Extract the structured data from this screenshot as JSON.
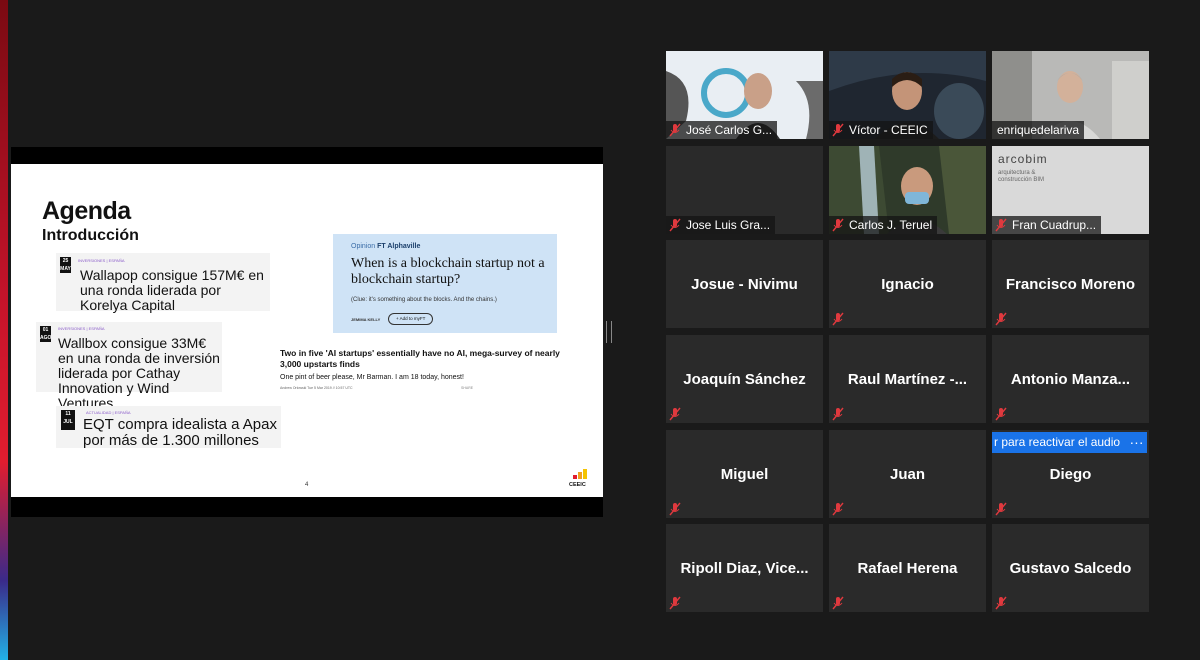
{
  "colors": {
    "background": "#1a1a1a",
    "tile_bg": "#2a2a2a",
    "active_speaker_border": "#c9e36f",
    "muted_icon": "#e0393e",
    "action_blue": "#1a73e8"
  },
  "slide": {
    "title": "Agenda",
    "subtitle": "Introducción",
    "page_number": "4",
    "logo_text": "CEEIC",
    "news": [
      {
        "date_day": "25",
        "date_month": "MAY",
        "tag": "INVERSIONES | España",
        "headline": "Wallapop consigue 157M€ en una ronda liderada por Korelya Capital"
      },
      {
        "date_day": "01",
        "date_month": "AGO",
        "tag": "INVERSIONES | España",
        "headline": "Wallbox consigue 33M€ en una ronda de inversión liderada por Cathay Innovation y Wind Ventures"
      },
      {
        "date_day": "11",
        "date_month": "JUL",
        "tag": "ACTUALIDAD | España",
        "headline": "EQT compra idealista a Apax por más de 1.300 millones"
      }
    ],
    "ft_card": {
      "label_prefix": "Opinion",
      "label_brand": "FT Alphaville",
      "headline": "When is a blockchain startup not a blockchain startup?",
      "clue": "(Clue: it's something about the blocks. And the chains.)",
      "author": "JEMIMA KELLY",
      "add_button": "+ Add to myFT"
    },
    "article": {
      "headline": "Two in five 'AI startups' essentially have no AI, mega-survey of nearly 3,000 upstarts finds",
      "dek": "One pint of beer please, Mr Barman. I am 18 today, honest!",
      "meta": "Andrew Orlowski   Tue 5 Mar 2019 // 10:57 UTC",
      "share": "SHARE"
    }
  },
  "participants": {
    "video_tiles": [
      {
        "name": "José Carlos G...",
        "muted": true,
        "active": false
      },
      {
        "name": "Víctor - CEEIC",
        "muted": true,
        "active": false
      },
      {
        "name": "enriquedelariva",
        "muted": false,
        "active": true
      },
      {
        "name": "Jose Luis Gra...",
        "muted": true,
        "active": false
      },
      {
        "name": "Carlos J. Teruel",
        "muted": true,
        "active": false
      },
      {
        "name": "Fran Cuadrup...",
        "muted": true,
        "active": false
      }
    ],
    "avatar_tiles": [
      {
        "name": "Josue - Nivimu"
      },
      {
        "name": "Ignacio"
      },
      {
        "name": "Francisco Moreno"
      },
      {
        "name": "Joaquín Sánchez"
      },
      {
        "name": "Raul Martínez -..."
      },
      {
        "name": "Antonio Manza..."
      },
      {
        "name": "Miguel"
      },
      {
        "name": "Juan"
      },
      {
        "name": "Diego"
      },
      {
        "name": "Ripoll Diaz, Vice..."
      },
      {
        "name": "Rafael Herena"
      },
      {
        "name": "Gustavo Salcedo"
      }
    ],
    "arcobim": {
      "logo": "arcobim",
      "tagline": "arquitectura & construcción BIM"
    }
  },
  "audio_tooltip": {
    "text": "r para reactivar el audio",
    "more_label": "···"
  }
}
